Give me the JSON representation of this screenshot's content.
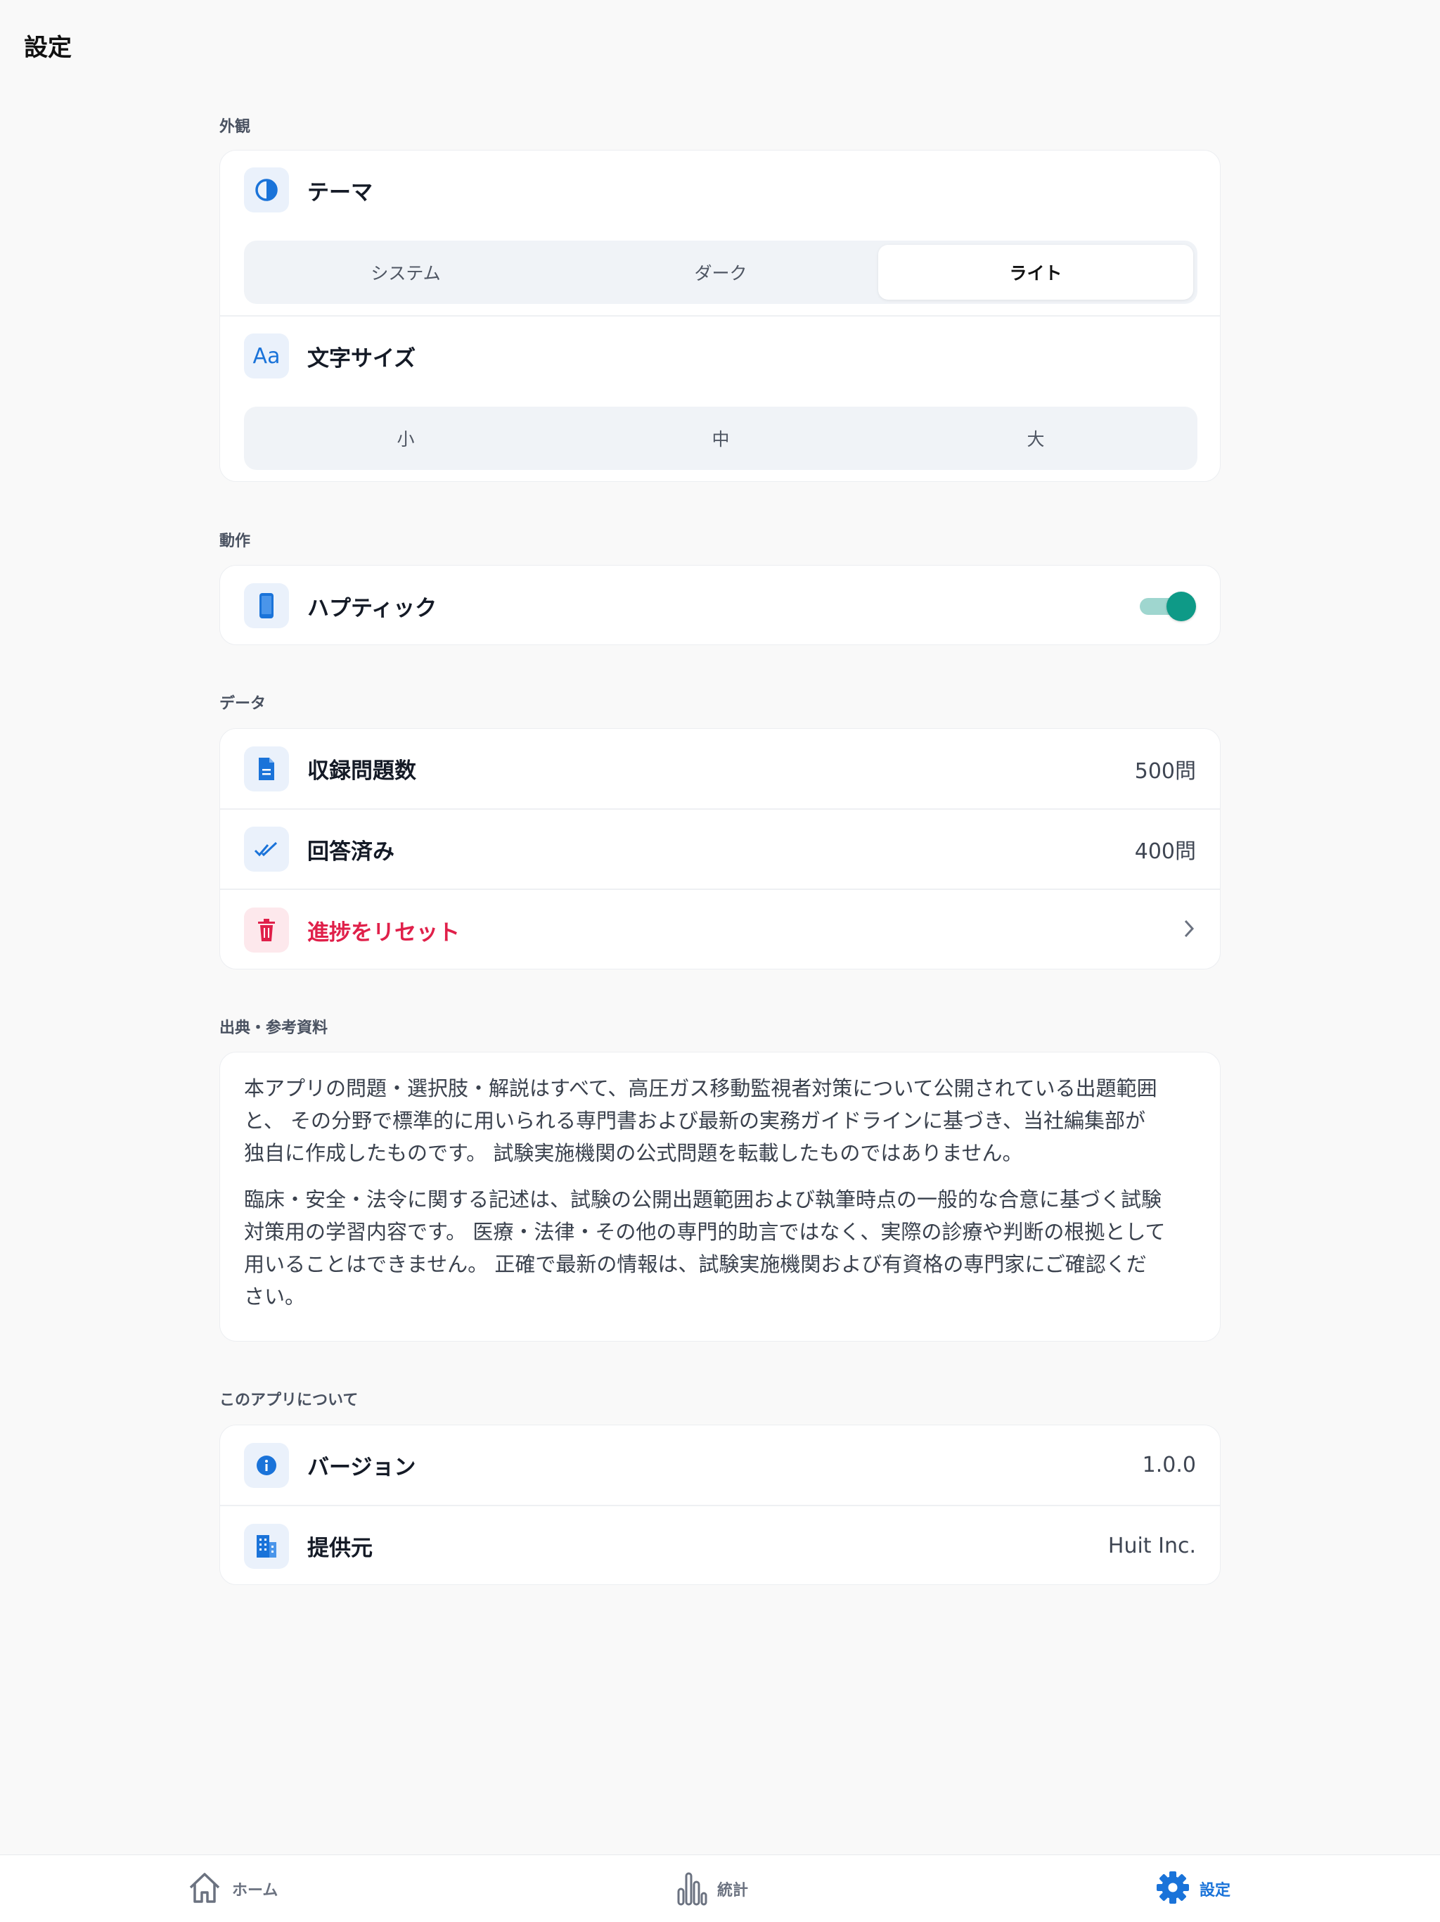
{
  "page": {
    "title": "設定"
  },
  "appearance": {
    "header": "外観",
    "theme": {
      "label": "テーマ",
      "icon": "contrast-icon",
      "options": [
        "システム",
        "ダーク",
        "ライト"
      ],
      "selected": "ライト"
    },
    "font_size": {
      "label": "文字サイズ",
      "icon": "text-size-icon",
      "icon_text": "Aa",
      "options": [
        "小",
        "中",
        "大"
      ],
      "selected": null
    }
  },
  "behavior": {
    "header": "動作",
    "haptic": {
      "label": "ハプティック",
      "icon": "phone-icon",
      "enabled": true
    }
  },
  "data": {
    "header": "データ",
    "items": [
      {
        "label": "収録問題数",
        "value": "500問",
        "icon": "document-icon"
      },
      {
        "label": "回答済み",
        "value": "400問",
        "icon": "double-check-icon"
      }
    ],
    "reset": {
      "label": "進捗をリセット",
      "icon": "trash-icon"
    }
  },
  "sources": {
    "header": "出典・参考資料",
    "paragraph1_lines": [
      "本アプリの問題・選択肢・解説はすべて、高圧ガス移動監視者対策について公開されている出題範囲",
      "と、 その分野で標準的に用いられる専門書および最新の実務ガイドラインに基づき、当社編集部が",
      "独自に作成したものです。 試験実施機関の公式問題を転載したものではありません。"
    ],
    "paragraph2_lines": [
      "臨床・安全・法令に関する記述は、試験の公開出題範囲および執筆時点の一般的な合意に基づく試験",
      "対策用の学習内容です。 医療・法律・その他の専門的助言ではなく、実際の診療や判断の根拠として",
      "用いることはできません。 正確で最新の情報は、試験実施機関および有資格の専門家にご確認くだ",
      "さい。"
    ]
  },
  "about": {
    "header": "このアプリについて",
    "items": [
      {
        "label": "バージョン",
        "value": "1.0.0",
        "icon": "info-icon"
      },
      {
        "label": "提供元",
        "value": "Huit Inc.",
        "icon": "building-icon"
      }
    ]
  },
  "tabbar": {
    "tabs": [
      {
        "label": "ホーム",
        "icon": "home-icon",
        "active": false
      },
      {
        "label": "統計",
        "icon": "chart-icon",
        "active": false
      },
      {
        "label": "設定",
        "icon": "gear-icon",
        "active": true
      }
    ]
  },
  "colors": {
    "accent": "#1a73d9",
    "toggle_on": "#0e9a87",
    "danger": "#e0204a",
    "background": "#f9f9f9"
  }
}
